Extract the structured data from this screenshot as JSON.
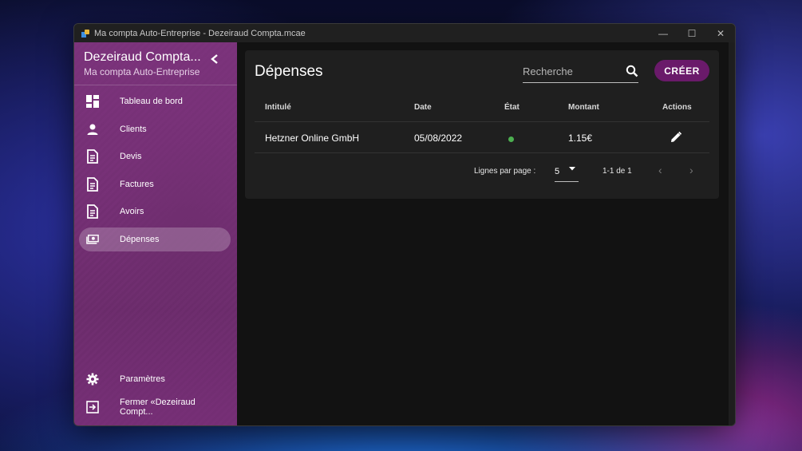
{
  "window": {
    "title": "Ma compta Auto-Entreprise - Dezeiraud Compta.mcae",
    "controls": {
      "minimize": "—",
      "maximize": "☐",
      "close": "✕"
    }
  },
  "sidebar": {
    "app_title": "Dezeiraud Compta...",
    "app_subtitle": "Ma compta Auto-Entreprise",
    "collapse_icon": "chevron-left-icon",
    "items": [
      {
        "label": "Tableau de bord",
        "icon": "dashboard-icon"
      },
      {
        "label": "Clients",
        "icon": "person-icon"
      },
      {
        "label": "Devis",
        "icon": "document-icon"
      },
      {
        "label": "Factures",
        "icon": "document-icon"
      },
      {
        "label": "Avoirs",
        "icon": "document-icon"
      },
      {
        "label": "Dépenses",
        "icon": "money-icon",
        "active": true
      }
    ],
    "footer_items": [
      {
        "label": "Paramètres",
        "icon": "gear-icon"
      },
      {
        "label": "Fermer «Dezeiraud Compt...",
        "icon": "exit-icon"
      }
    ],
    "accent_color": "#7d327d"
  },
  "main": {
    "title": "Dépenses",
    "search": {
      "placeholder": "Recherche",
      "value": ""
    },
    "create_label": "CRÉER",
    "create_color": "#6a1a6a",
    "table": {
      "headers": [
        "Intitulé",
        "Date",
        "État",
        "Montant",
        "Actions"
      ],
      "rows": [
        {
          "title": "Hetzner Online GmbH",
          "date": "05/08/2022",
          "status_color": "#4caf50",
          "amount": "1.15€",
          "action_icon": "pencil-icon"
        }
      ]
    },
    "pagination": {
      "rows_per_page_label": "Lignes par page :",
      "rows_per_page_value": "5",
      "range": "1-1 de 1",
      "prev": "‹",
      "next": "›"
    }
  }
}
